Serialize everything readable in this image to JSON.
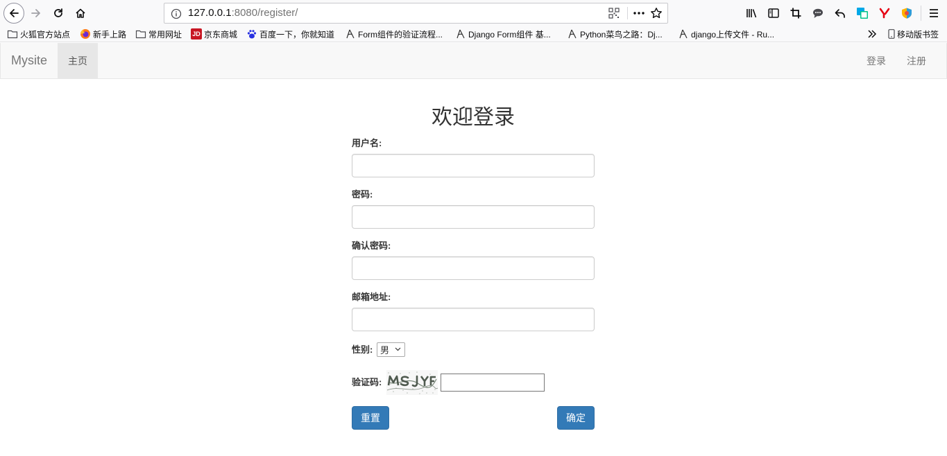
{
  "browser": {
    "url_host": "127.0.0.1",
    "url_rest": ":8080/register/",
    "bookmarks": [
      {
        "label": "火狐官方站点",
        "icon": "folder-icon"
      },
      {
        "label": "新手上路",
        "icon": "firefox-icon"
      },
      {
        "label": "常用网址",
        "icon": "folder-icon"
      },
      {
        "label": "京东商城",
        "icon": "jd-icon",
        "icon_text": "JD"
      },
      {
        "label": "百度一下，你就知道",
        "icon": "baidu-paw-icon"
      },
      {
        "label": "Form组件的验证流程...",
        "icon": "blog-icon"
      },
      {
        "label": "Django Form组件 基...",
        "icon": "blog-icon"
      },
      {
        "label": "Python菜鸟之路：Dj...",
        "icon": "blog-icon"
      },
      {
        "label": "django上传文件 - Ru...",
        "icon": "blog-icon"
      }
    ],
    "mobile_bookmarks": "移动版书签",
    "accent_color": "#0a84ff"
  },
  "navbar": {
    "brand": "Mysite",
    "home": "主页",
    "login": "登录",
    "register": "注册"
  },
  "form": {
    "title": "欢迎登录",
    "username_label": "用户名:",
    "username_value": "",
    "password_label": "密码:",
    "password_value": "",
    "confirm_label": "确认密码:",
    "confirm_value": "",
    "email_label": "邮箱地址:",
    "email_value": "",
    "gender_label": "性别:",
    "gender_selected": "男",
    "captcha_label": "验证码:",
    "captcha_value": "",
    "reset_label": "重置",
    "submit_label": "确定",
    "button_color": "#337ab7"
  }
}
